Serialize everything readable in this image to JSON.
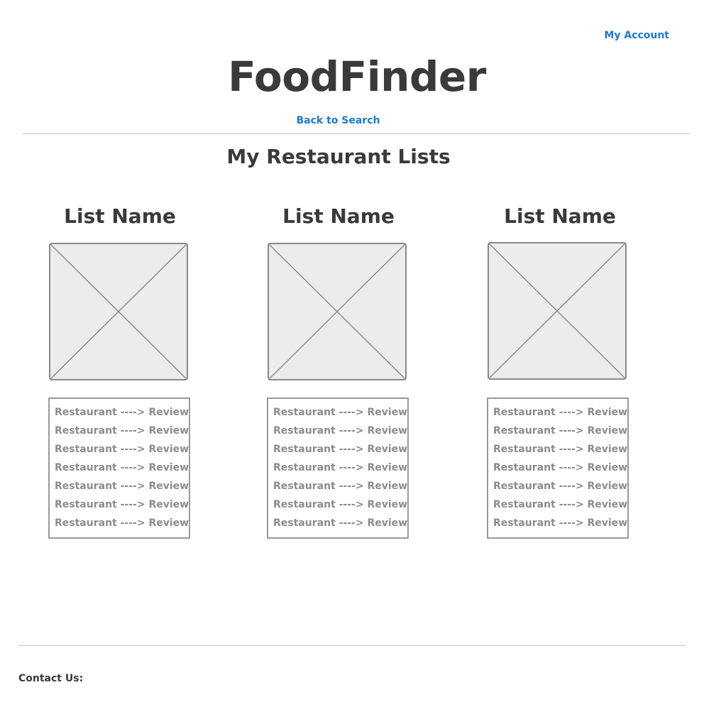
{
  "header": {
    "account_link": "My Account",
    "app_title": "FoodFinder",
    "back_link": "Back to Search"
  },
  "main": {
    "heading": "My Restaurant Lists",
    "lists": [
      {
        "title": "List Name",
        "image_icon": "image-placeholder-icon",
        "entries": [
          "Restaurant ----> Review",
          "Restaurant ----> Review",
          "Restaurant ----> Review",
          "Restaurant ----> Review",
          "Restaurant ----> Review",
          "Restaurant ----> Review",
          "Restaurant ----> Review"
        ]
      },
      {
        "title": "List Name",
        "image_icon": "image-placeholder-icon",
        "entries": [
          "Restaurant ----> Review",
          "Restaurant ----> Review",
          "Restaurant ----> Review",
          "Restaurant ----> Review",
          "Restaurant ----> Review",
          "Restaurant ----> Review",
          "Restaurant ----> Review"
        ]
      },
      {
        "title": "List Name",
        "image_icon": "image-placeholder-icon",
        "entries": [
          "Restaurant ----> Review",
          "Restaurant ----> Review",
          "Restaurant ----> Review",
          "Restaurant ----> Review",
          "Restaurant ----> Review",
          "Restaurant ----> Review",
          "Restaurant ----> Review"
        ]
      }
    ]
  },
  "footer": {
    "contact_label": "Contact Us:"
  },
  "colors": {
    "link": "#1a7bd0",
    "text": "#3a3a3a",
    "muted_text": "#8c8c8c",
    "placeholder_fill": "#ececec",
    "border": "#8a8a8a"
  }
}
